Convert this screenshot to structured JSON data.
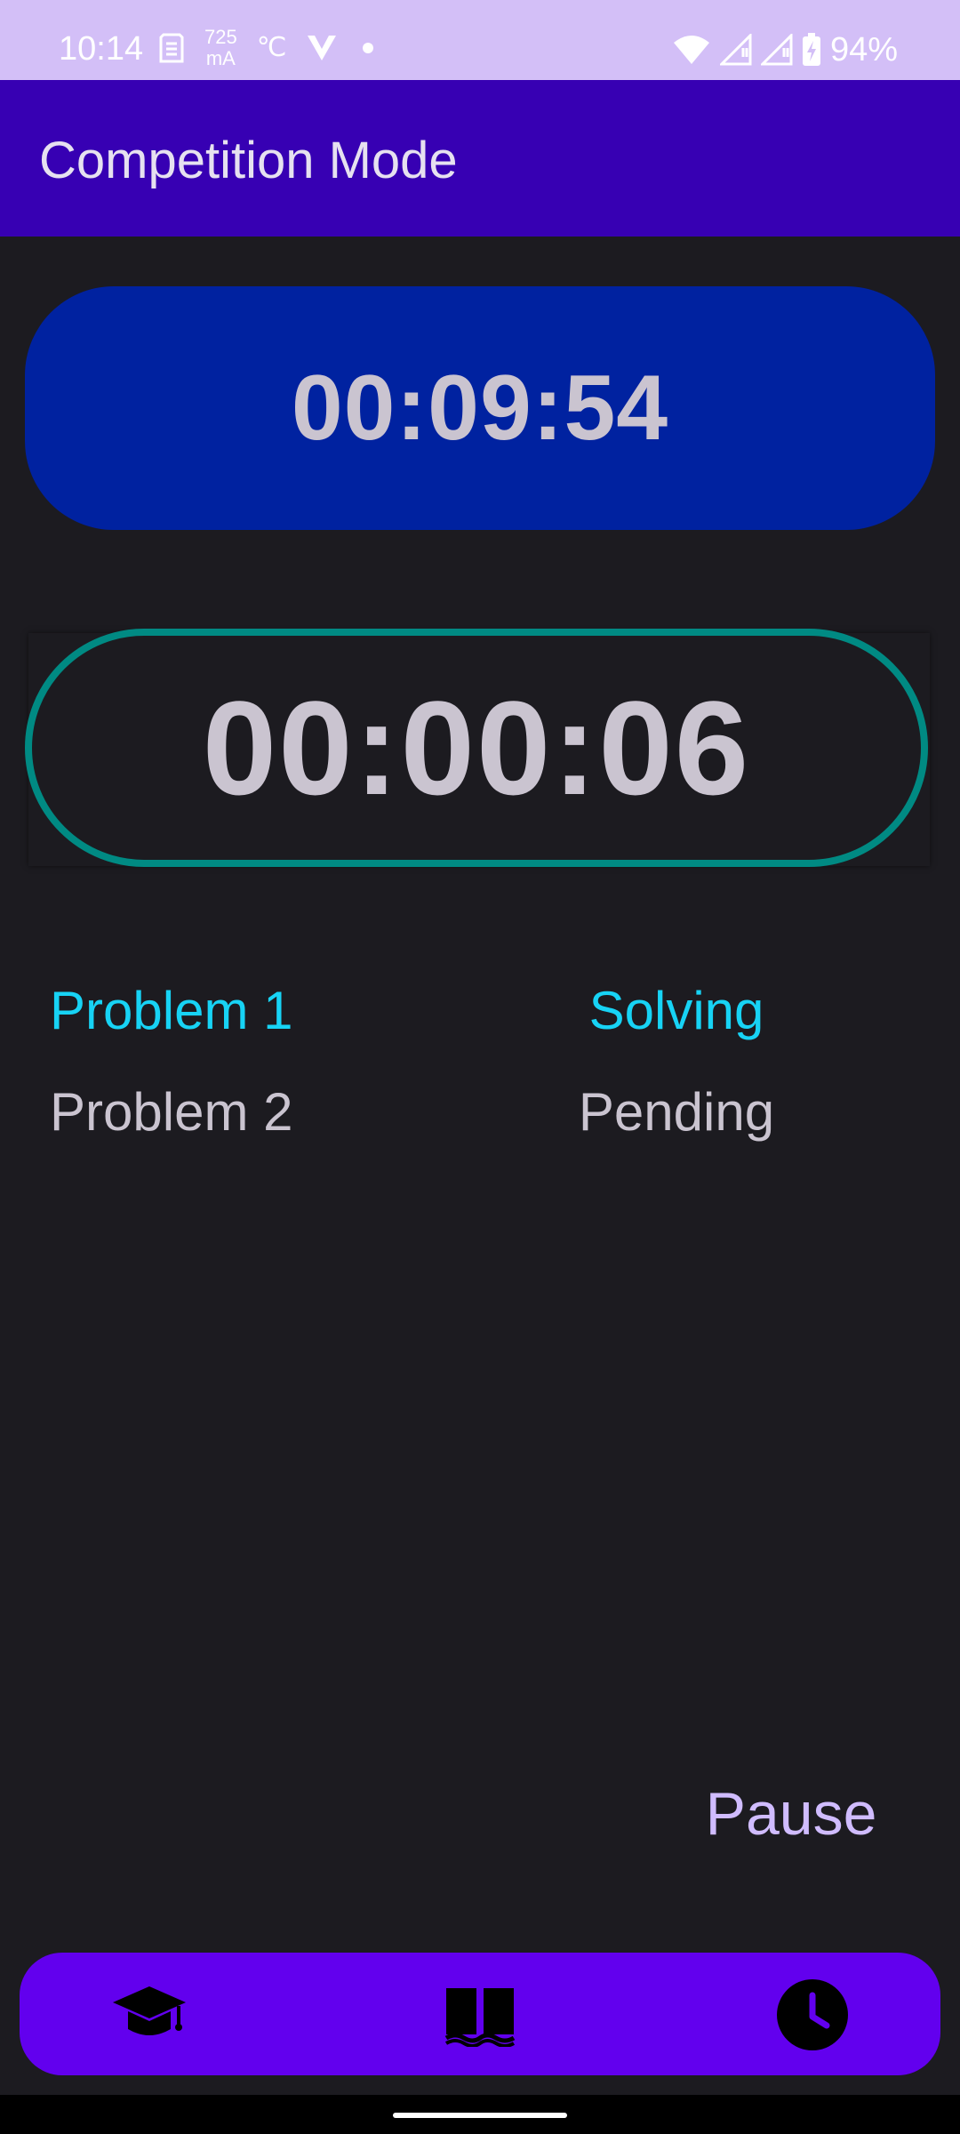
{
  "status_bar": {
    "time": "10:14",
    "current_value": "725",
    "current_unit": "mA",
    "temperature_unit": "℃",
    "battery": "94%",
    "icons": [
      "sim-card-icon",
      "temperature-icon",
      "v-app-icon",
      "notification-dot-icon",
      "wifi-icon",
      "signal-icon-1",
      "signal-icon-2",
      "battery-charging-icon"
    ]
  },
  "app_bar": {
    "title": "Competition Mode"
  },
  "timers": {
    "total": "00:09:54",
    "current_problem": "00:00:06"
  },
  "problems": [
    {
      "name": "Problem 1",
      "status": "Solving",
      "color": "#17d3f5"
    },
    {
      "name": "Problem 2",
      "status": "Pending",
      "color": "#cac4d0"
    }
  ],
  "actions": {
    "pause_label": "Pause"
  },
  "bottom_nav": {
    "items": [
      {
        "icon": "graduation-cap-icon"
      },
      {
        "icon": "book-icon"
      },
      {
        "icon": "clock-icon"
      }
    ]
  },
  "colors": {
    "status_bar": "#d3bff7",
    "app_bar": "#3700b3",
    "background": "#1c1b20",
    "main_timer": "#0022a0",
    "problem_timer_border": "#008a83",
    "active_problem": "#17d3f5",
    "nav_bar": "#6200ee",
    "pause": "#d0bcff"
  }
}
